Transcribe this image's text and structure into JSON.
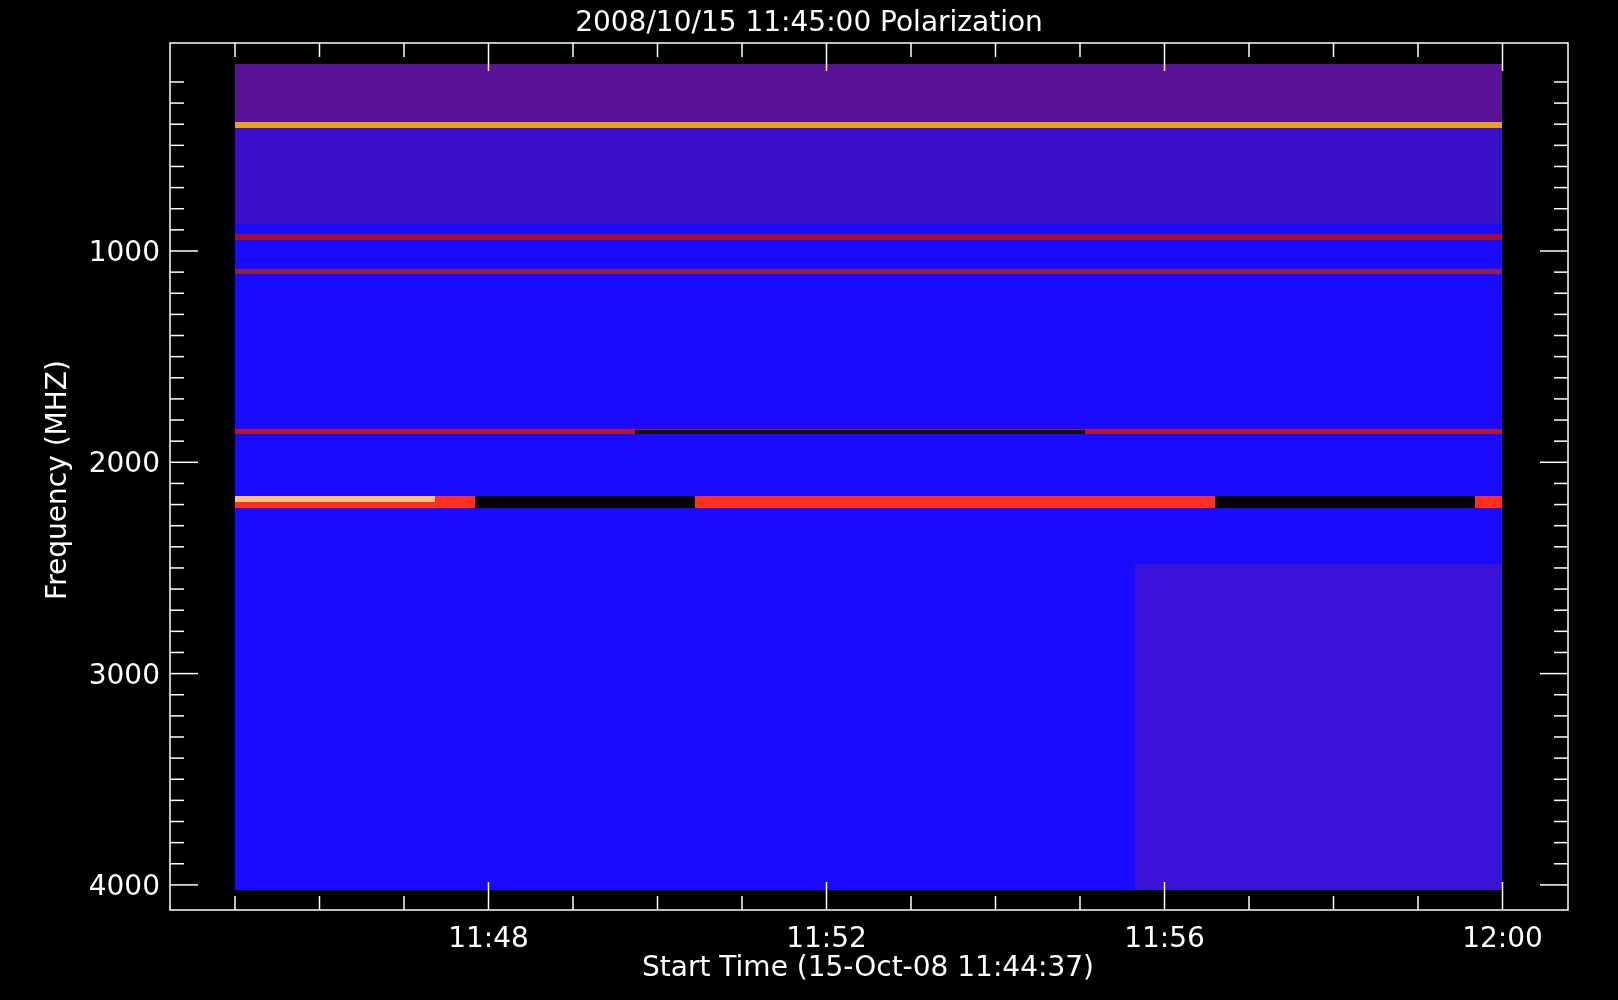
{
  "title": "2008/10/15 11:45:00 Polarization",
  "y_axis": {
    "label": "Frequency (MHZ)",
    "ticks": [
      "1000",
      "2000",
      "3000",
      "4000"
    ]
  },
  "x_axis": {
    "label": "Start Time (15-Oct-08 11:44:37)",
    "ticks": [
      "11:48",
      "11:52",
      "11:56",
      "12:00"
    ]
  }
}
